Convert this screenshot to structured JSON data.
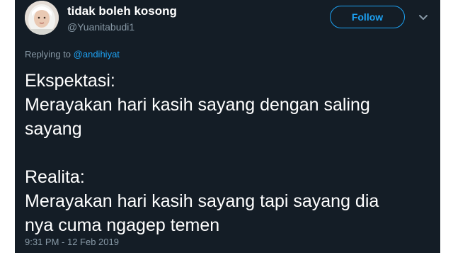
{
  "tweet": {
    "author": {
      "display_name": "tidak boleh kosong",
      "handle": "@Yuanitabudi1"
    },
    "follow_label": "Follow",
    "reply": {
      "prefix": "Replying to",
      "mention": "@andihiyat"
    },
    "lines": [
      "Ekspektasi:",
      "Merayakan hari kasih sayang dengan saling",
      "sayang",
      "Realita:",
      "Merayakan hari kasih sayang tapi sayang dia",
      "nya cuma ngagep temen"
    ],
    "timestamp": "9:31 PM - 12 Feb 2019"
  },
  "colors": {
    "background": "#141d26",
    "text": "#ffffff",
    "secondary": "#8899a6",
    "accent": "#1da1f2"
  },
  "icons": {
    "avatar": "profile-photo",
    "menu": "chevron-down-icon"
  }
}
